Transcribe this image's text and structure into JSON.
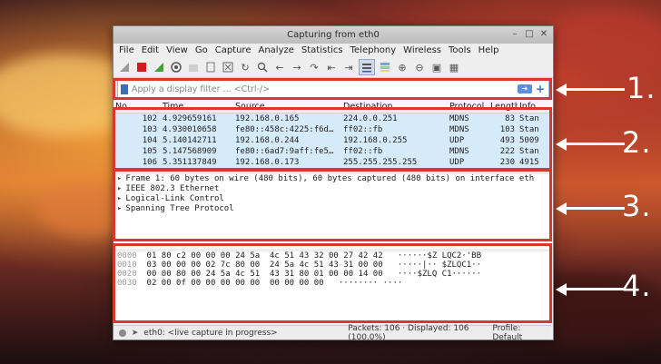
{
  "window": {
    "title": "Capturing from eth0"
  },
  "menu": [
    "File",
    "Edit",
    "View",
    "Go",
    "Capture",
    "Analyze",
    "Statistics",
    "Telephony",
    "Wireless",
    "Tools",
    "Help"
  ],
  "filter": {
    "placeholder": "Apply a display filter ... <Ctrl-/>"
  },
  "packet_list": {
    "headers": {
      "no": "No.",
      "time": "Time",
      "source": "Source",
      "destination": "Destination",
      "protocol": "Protocol",
      "length": "Length",
      "info": "Info"
    },
    "rows": [
      {
        "no": "102",
        "time": "4.929659161",
        "source": "192.168.0.165",
        "destination": "224.0.0.251",
        "protocol": "MDNS",
        "length": "83",
        "info": "Stan"
      },
      {
        "no": "103",
        "time": "4.930010658",
        "source": "fe80::458c:4225:f6d…",
        "destination": "ff02::fb",
        "protocol": "MDNS",
        "length": "103",
        "info": "Stan"
      },
      {
        "no": "104",
        "time": "5.140142711",
        "source": "192.168.0.244",
        "destination": "192.168.0.255",
        "protocol": "UDP",
        "length": "493",
        "info": "5009"
      },
      {
        "no": "105",
        "time": "5.147568909",
        "source": "fe80::6ad7:9aff:fe5…",
        "destination": "ff02::fb",
        "protocol": "MDNS",
        "length": "222",
        "info": "Stan"
      },
      {
        "no": "106",
        "time": "5.351137849",
        "source": "192.168.0.173",
        "destination": "255.255.255.255",
        "protocol": "UDP",
        "length": "230",
        "info": "4915"
      }
    ]
  },
  "details": [
    "Frame 1: 60 bytes on wire (480 bits), 60 bytes captured (480 bits) on interface eth",
    "IEEE 802.3 Ethernet",
    "Logical-Link Control",
    "Spanning Tree Protocol"
  ],
  "bytes": [
    {
      "offset": "0000",
      "hex": "01 80 c2 00 00 00 24 5a  4c 51 43 32 00 27 42 42",
      "ascii": "······$Z LQC2·'BB"
    },
    {
      "offset": "0010",
      "hex": "03 00 00 00 02 7c 80 00  24 5a 4c 51 43 31 00 00",
      "ascii": "·····|·· $ZLQC1··"
    },
    {
      "offset": "0020",
      "hex": "00 00 80 00 24 5a 4c 51  43 31 80 01 00 00 14 00",
      "ascii": "····$ZLQ C1······"
    },
    {
      "offset": "0030",
      "hex": "02 00 0f 00 00 00 00 00  00 00 00 00",
      "ascii": "········ ····"
    }
  ],
  "status": {
    "capture": "eth0: <live capture in progress>",
    "packets": "Packets: 106 · Displayed: 106 (100.0%)",
    "profile": "Profile: Default"
  },
  "callouts": [
    "1.",
    "2.",
    "3.",
    "4."
  ],
  "colors": {
    "highlight": "#d9392c",
    "selection": "#d6ebfa"
  }
}
